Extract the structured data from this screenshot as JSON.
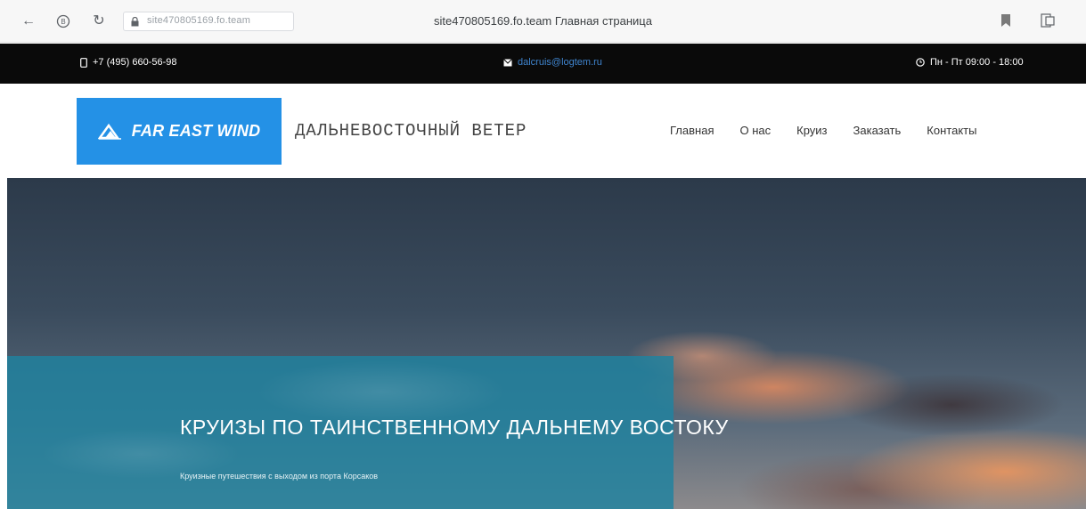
{
  "browser": {
    "url": "site470805169.fo.team",
    "page_title": "site470805169.fo.team Главная страница",
    "icons": [
      "back-arrow-icon",
      "reader-icon",
      "reload-icon",
      "lock-icon",
      "bookmark-icon",
      "extension-icon"
    ]
  },
  "topbar": {
    "phone": "+7 (495) 660-56-98",
    "email": "dalcruis@logtem.ru",
    "hours": "Пн - Пт 09:00 - 18:00",
    "icons": [
      "phone-icon",
      "envelope-icon",
      "clock-icon"
    ]
  },
  "header": {
    "logo_text": "FAR EAST WIND",
    "tagline": "ДАЛЬНЕВОСТОЧНЫЙ ВЕТЕР",
    "nav": [
      "Главная",
      "О нас",
      "Круиз",
      "Заказать",
      "Контакты"
    ],
    "brand_color": "#2491e6"
  },
  "hero": {
    "title": "КРУИЗЫ ПО ТАИНСТВЕННОМУ ДАЛЬНЕМУ ВОСТОКУ",
    "subtitle": "Круизные путешествия с выходом из порта Корсаков",
    "panel_color": "#1e82a0"
  }
}
